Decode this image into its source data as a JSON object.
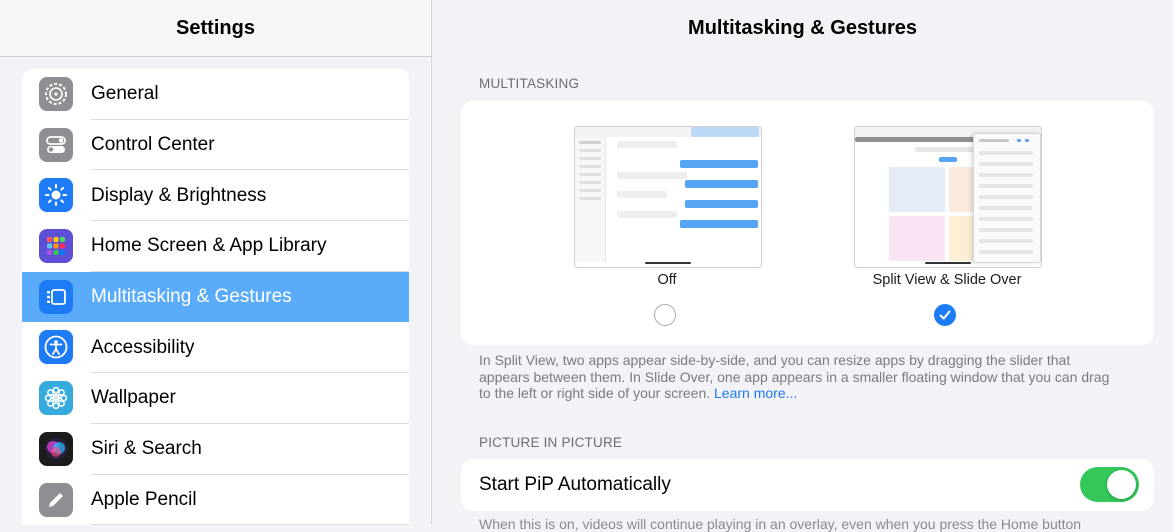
{
  "left": {
    "title": "Settings",
    "items": [
      {
        "label": "General",
        "icon": "gear-icon",
        "color": "#8e8e93"
      },
      {
        "label": "Control Center",
        "icon": "toggles-icon",
        "color": "#8e8e93"
      },
      {
        "label": "Display & Brightness",
        "icon": "sun-icon",
        "color": "#1d7bf5"
      },
      {
        "label": "Home Screen & App Library",
        "icon": "app-grid-icon",
        "color": "#5e4fd8"
      },
      {
        "label": "Multitasking & Gestures",
        "icon": "multitasking-icon",
        "color": "#1d7bf5",
        "selected": true
      },
      {
        "label": "Accessibility",
        "icon": "accessibility-icon",
        "color": "#1d7bf5"
      },
      {
        "label": "Wallpaper",
        "icon": "flower-icon",
        "color": "#35aadc"
      },
      {
        "label": "Siri & Search",
        "icon": "siri-icon",
        "color": "#222"
      },
      {
        "label": "Apple Pencil",
        "icon": "pencil-icon",
        "color": "#8e8e93"
      }
    ]
  },
  "right": {
    "title": "Multitasking & Gestures",
    "multitasking": {
      "section_label": "MULTITASKING",
      "options": [
        {
          "label": "Off",
          "selected": false
        },
        {
          "label": "Split View & Slide Over",
          "selected": true
        }
      ],
      "description": "In Split View, two apps appear side-by-side, and you can resize apps by dragging the slider that appears between them. In Slide Over, one app appears in a smaller floating window that you can drag to the left or right side of your screen.",
      "learn_more": "Learn more..."
    },
    "pip": {
      "section_label": "PICTURE IN PICTURE",
      "label": "Start PiP Automatically",
      "enabled": true,
      "note": "When this is on, videos will continue playing in an overlay, even when you press the Home button"
    }
  },
  "colors": {
    "accent": "#1d7bf5",
    "selected_row": "#5aacfb",
    "toggle_on": "#34c759"
  }
}
